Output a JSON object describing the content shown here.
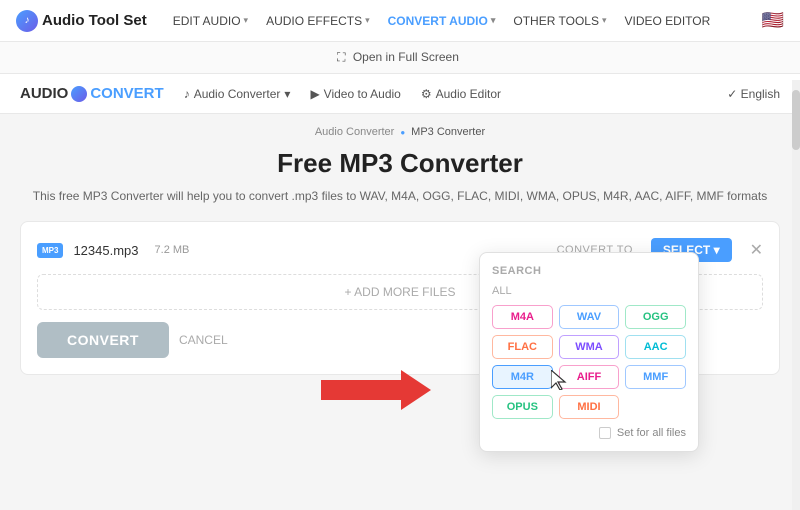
{
  "topNav": {
    "logo": "Audio",
    "logoSuffix": "Tool Set",
    "items": [
      {
        "label": "EDIT AUDIO",
        "hasDropdown": true,
        "active": false
      },
      {
        "label": "AUDIO EFFECTS",
        "hasDropdown": true,
        "active": false
      },
      {
        "label": "CONVERT AUDIO",
        "hasDropdown": true,
        "active": true
      },
      {
        "label": "OTHER TOOLS",
        "hasDropdown": true,
        "active": false
      },
      {
        "label": "VIDEO EDITOR",
        "hasDropdown": false,
        "active": false
      }
    ],
    "flag": "🇺🇸"
  },
  "fullscreenBar": {
    "icon": "⛶",
    "label": "Open in Full Screen"
  },
  "innerNav": {
    "logo": "AUDIO",
    "logoConnector": "🔁",
    "logoEnd": "CONVERT",
    "items": [
      {
        "icon": "♪",
        "label": "Audio Converter",
        "hasDropdown": true
      },
      {
        "icon": "▶",
        "label": "Video to Audio"
      },
      {
        "icon": "⚙",
        "label": "Audio Editor"
      }
    ],
    "language": "English"
  },
  "breadcrumb": {
    "parent": "Audio Converter",
    "current": "MP3 Converter"
  },
  "pageTitle": "Free MP3 Converter",
  "pageDesc": "This free MP3 Converter will help you to convert .mp3 files to WAV, M4A, OGG, FLAC, MIDI, WMA, OPUS, M4R, AAC, AIFF, MMF\nformats",
  "file": {
    "format": "MP3",
    "name": "12345.mp3",
    "size": "7.2 MB"
  },
  "convertToLabel": "CONVERT TO",
  "selectBtn": "SELECT ▾",
  "addMoreFiles": "+ ADD MORE FILES",
  "convertBtn": "CONVERT",
  "cancelLink": "CANCEL",
  "dropdown": {
    "searchLabel": "SEARCH",
    "allLabel": "ALL",
    "formats": [
      {
        "label": "M4A",
        "style": "pink"
      },
      {
        "label": "WAV",
        "style": "blue"
      },
      {
        "label": "OGG",
        "style": "green"
      },
      {
        "label": "FLAC",
        "style": "orange"
      },
      {
        "label": "WMA",
        "style": "purple"
      },
      {
        "label": "AAC",
        "style": "teal"
      },
      {
        "label": "M4R",
        "style": "selected"
      },
      {
        "label": "AIFF",
        "style": "pink"
      },
      {
        "label": "MMF",
        "style": "blue"
      },
      {
        "label": "OPUS",
        "style": "green"
      },
      {
        "label": "MIDI",
        "style": "orange"
      }
    ],
    "setForAll": "Set for all files"
  }
}
